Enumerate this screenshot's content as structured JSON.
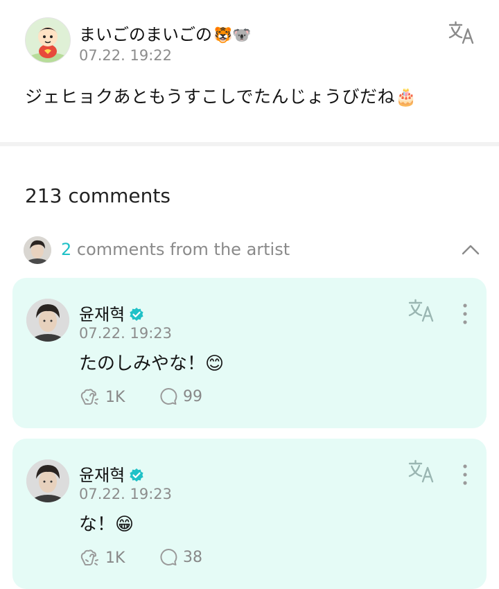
{
  "post": {
    "author": "まいごのまいごの",
    "author_emoji": "🐯🐨",
    "timestamp": "07.22. 19:22",
    "text": "ジェヒョクあともうすこしでたんじょうびだね🎂",
    "translate_icon": "translate-icon"
  },
  "comments_section": {
    "count_label": "213 comments",
    "artist_count": "2",
    "artist_label": "comments from the artist",
    "collapse_icon": "chevron-up-icon"
  },
  "artist_comments": [
    {
      "name": "윤재혁",
      "verified_icon": "verified-badge-icon",
      "timestamp": "07.22. 19:23",
      "text": "たのしみやな！😊",
      "likes": "1K",
      "replies": "99"
    },
    {
      "name": "윤재혁",
      "verified_icon": "verified-badge-icon",
      "timestamp": "07.22. 19:23",
      "text": "な！😁",
      "likes": "1K",
      "replies": "38"
    }
  ],
  "colors": {
    "accent": "#1fc1c7",
    "card_bg": "#e5fbf6",
    "muted_text": "#8c8c8c"
  }
}
